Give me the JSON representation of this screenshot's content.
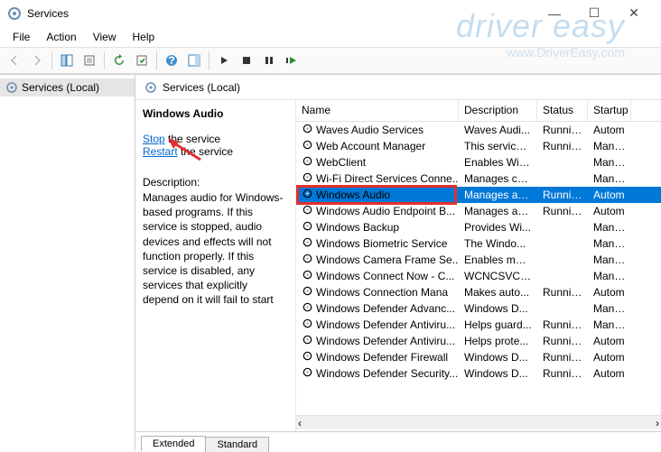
{
  "window": {
    "title": "Services"
  },
  "menu": {
    "file": "File",
    "action": "Action",
    "view": "View",
    "help": "Help"
  },
  "tree": {
    "root": "Services (Local)"
  },
  "header": {
    "label": "Services (Local)"
  },
  "detail": {
    "name": "Windows Audio",
    "stop_link": "Stop",
    "stop_rest": " the service",
    "restart_link": "Restart",
    "restart_rest": " the service",
    "desc_label": "Description:",
    "desc_text": "Manages audio for Windows-based programs.  If this service is stopped, audio devices and effects will not function properly.  If this service is disabled, any services that explicitly depend on it will fail to start"
  },
  "columns": {
    "name": "Name",
    "desc": "Description",
    "status": "Status",
    "startup": "Startup"
  },
  "tabs": {
    "extended": "Extended",
    "standard": "Standard"
  },
  "watermark": {
    "brand": "driver easy",
    "url": "www.DriverEasy.com"
  },
  "rows": [
    {
      "name": "Waves Audio Services",
      "desc": "Waves Audi...",
      "status": "Running",
      "startup": "Autom"
    },
    {
      "name": "Web Account Manager",
      "desc": "This service ...",
      "status": "Running",
      "startup": "Manua"
    },
    {
      "name": "WebClient",
      "desc": "Enables Win...",
      "status": "",
      "startup": "Manua"
    },
    {
      "name": "Wi-Fi Direct Services Conne...",
      "desc": "Manages co...",
      "status": "",
      "startup": "Manua"
    },
    {
      "name": "Windows Audio",
      "desc": "Manages au...",
      "status": "Running",
      "startup": "Autom",
      "selected": true
    },
    {
      "name": "Windows Audio Endpoint B...",
      "desc": "Manages au...",
      "status": "Running",
      "startup": "Autom"
    },
    {
      "name": "Windows Backup",
      "desc": "Provides Wi...",
      "status": "",
      "startup": "Manua"
    },
    {
      "name": "Windows Biometric Service",
      "desc": "The Windo...",
      "status": "",
      "startup": "Manua"
    },
    {
      "name": "Windows Camera Frame Se...",
      "desc": "Enables mul...",
      "status": "",
      "startup": "Manua"
    },
    {
      "name": "Windows Connect Now - C...",
      "desc": "WCNCSVC ...",
      "status": "",
      "startup": "Manua"
    },
    {
      "name": "Windows Connection Mana",
      "desc": "Makes auto...",
      "status": "Running",
      "startup": "Autom"
    },
    {
      "name": "Windows Defender Advanc...",
      "desc": "Windows D...",
      "status": "",
      "startup": "Manua"
    },
    {
      "name": "Windows Defender Antiviru...",
      "desc": "Helps guard...",
      "status": "Running",
      "startup": "Manua"
    },
    {
      "name": "Windows Defender Antiviru...",
      "desc": "Helps prote...",
      "status": "Running",
      "startup": "Autom"
    },
    {
      "name": "Windows Defender Firewall",
      "desc": "Windows D...",
      "status": "Running",
      "startup": "Autom"
    },
    {
      "name": "Windows Defender Security...",
      "desc": "Windows D...",
      "status": "Running",
      "startup": "Autom"
    }
  ]
}
